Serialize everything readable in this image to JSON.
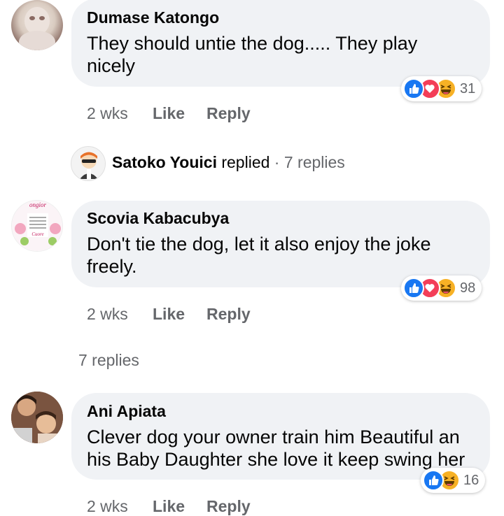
{
  "colors": {
    "like_blue": "#1877f2",
    "love_red": "#f33e58",
    "haha_yellow": "#f7b125",
    "bubble_bg": "#f0f2f5",
    "meta_gray": "#65676b"
  },
  "comments": [
    {
      "author": "Dumase Katongo",
      "text": "They should untie the dog..... They play nicely",
      "reactions": [
        "like-icon",
        "love-icon",
        "haha-icon"
      ],
      "reaction_count": "31",
      "time": "2 wks",
      "like_label": "Like",
      "reply_label": "Reply"
    },
    {
      "author": "Scovia Kabacubya",
      "text": "Don't tie the dog, let it also enjoy the joke freely.",
      "reactions": [
        "like-icon",
        "love-icon",
        "haha-icon"
      ],
      "reaction_count": "98",
      "time": "2 wks",
      "like_label": "Like",
      "reply_label": "Reply",
      "view_replies": "7 replies"
    },
    {
      "author": "Ani Apiata",
      "text": "Clever dog your owner train him Beautiful an his Baby Daughter she love it keep swing her",
      "reactions": [
        "like-icon",
        "haha-icon"
      ],
      "reaction_count": "16",
      "time": "2 wks",
      "like_label": "Like",
      "reply_label": "Reply"
    }
  ],
  "reply_summary": {
    "author": "Satoko Youici",
    "action": "replied",
    "separator": "·",
    "count": "7 replies"
  }
}
